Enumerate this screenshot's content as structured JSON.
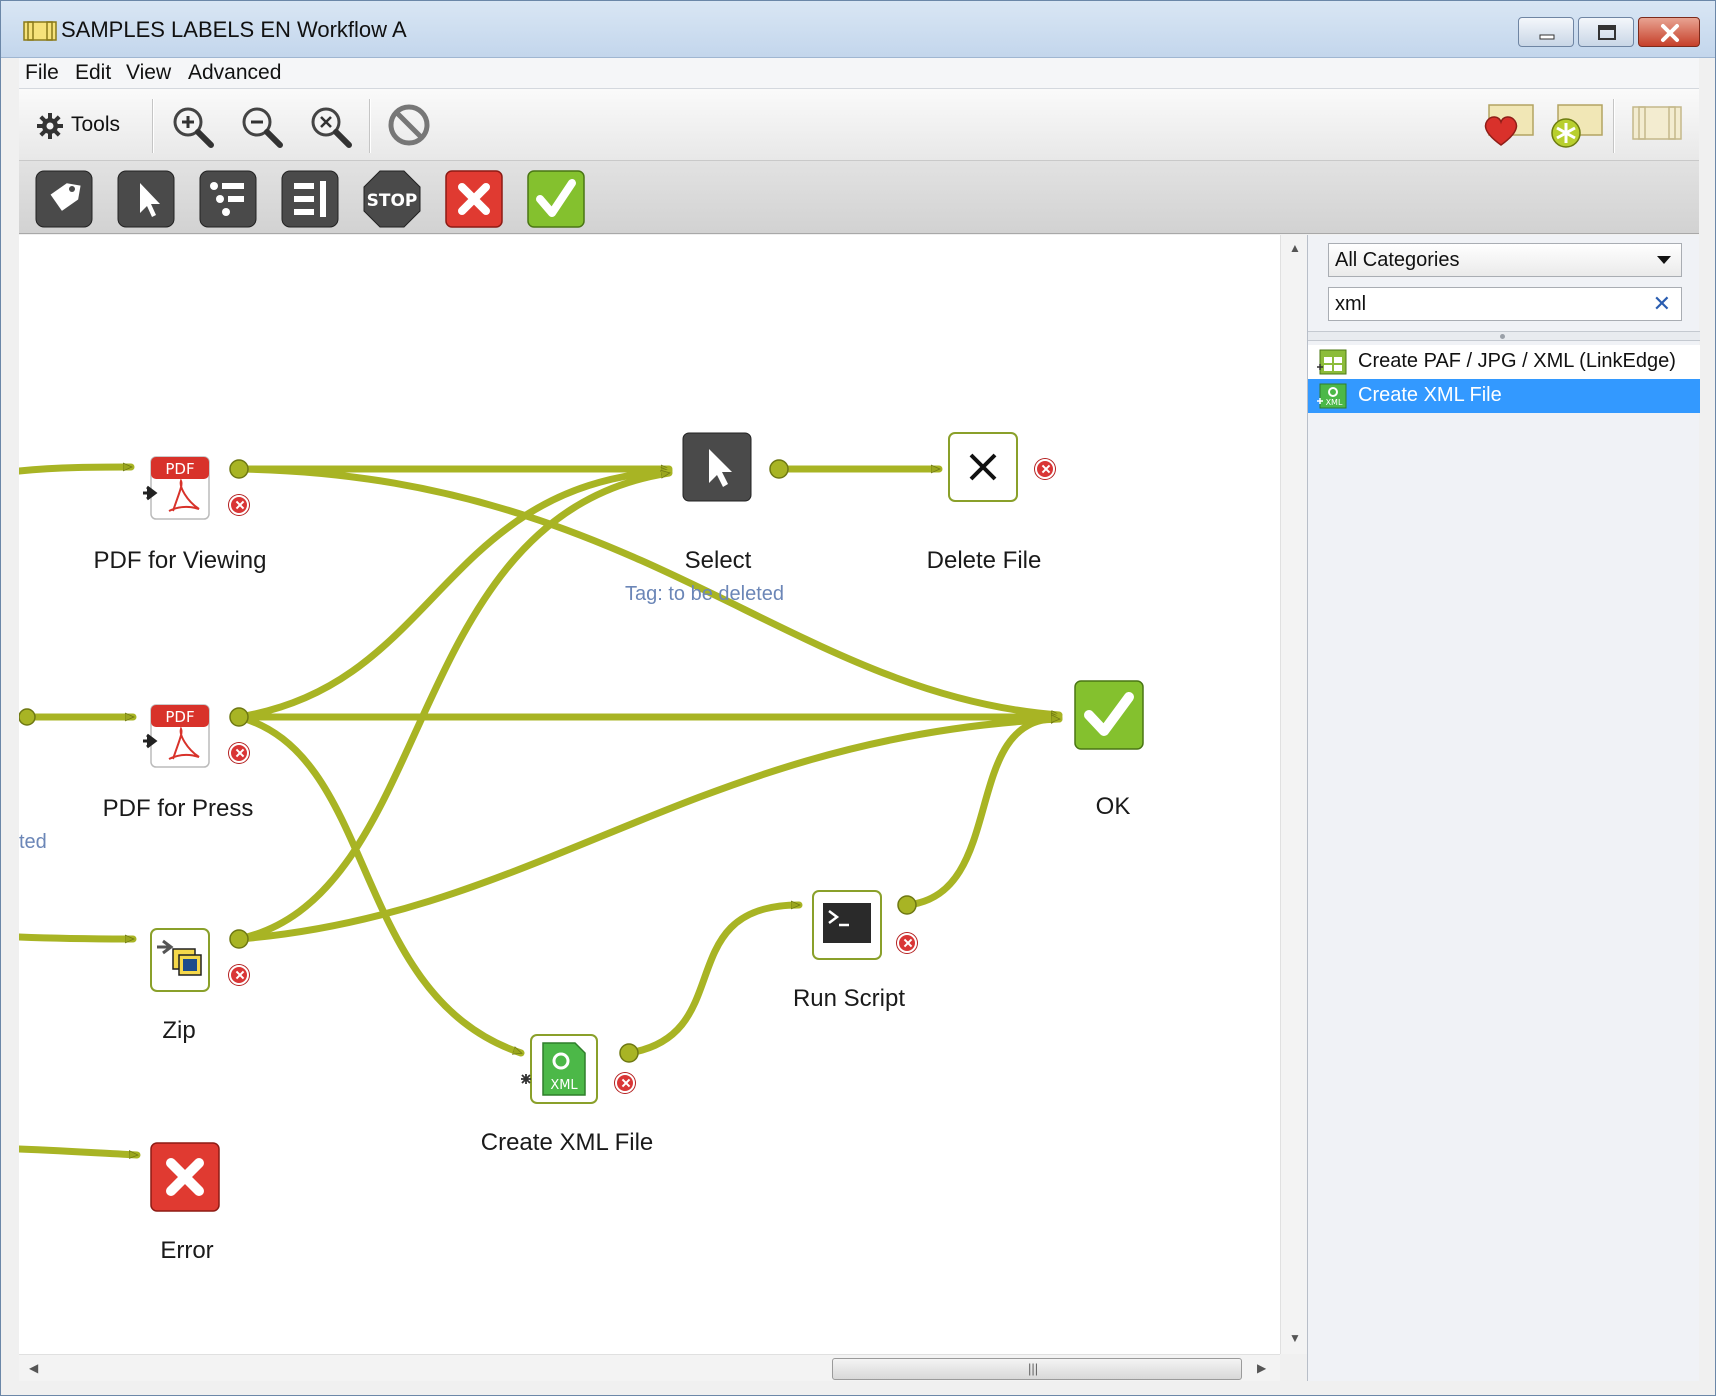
{
  "window": {
    "title": "SAMPLES LABELS EN Workflow A"
  },
  "menu": {
    "file": "File",
    "edit": "Edit",
    "view": "View",
    "advanced": "Advanced"
  },
  "toolbar": {
    "tools_label": "Tools"
  },
  "toolbar2": {
    "stop_label": "STOP"
  },
  "nodes": {
    "pdf_viewing": "PDF for Viewing",
    "pdf_press": "PDF for Press",
    "zip": "Zip",
    "error": "Error",
    "select": "Select",
    "select_tag": "Tag: to be deleted",
    "delete_file": "Delete File",
    "ok": "OK",
    "run_script": "Run Script",
    "create_xml": "Create XML File",
    "partial_label": "ted"
  },
  "panel": {
    "category": "All Categories",
    "search_value": "xml",
    "items": [
      {
        "label": "Create PAF / JPG / XML (LinkEdge)"
      },
      {
        "label": "Create XML File"
      }
    ]
  },
  "colors": {
    "connector": "#9aa61e",
    "selected": "#3399ff",
    "error": "#d93636",
    "ok": "#7cb828"
  }
}
